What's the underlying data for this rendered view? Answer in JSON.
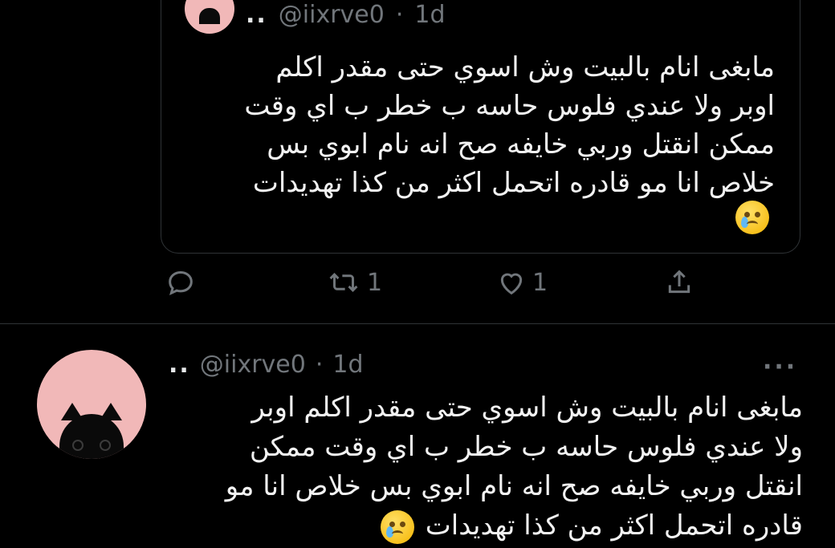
{
  "quote": {
    "author_dots": "..",
    "handle": "@iixrve0",
    "separator": "·",
    "time": "1d",
    "lines": [
      "مابغى انام بالبيت  وش اسوي  حتى مقدر اكلم",
      "اوبر  ولا عندي فلوس حاسه ب خطر ب اي وقت",
      "ممكن انقتل وربي خايفه صح انه نام ابوي بس",
      "خلاص انا مو قادره اتحمل اكثر من كذا تهديدات"
    ],
    "emoji": "crying-face-emoji"
  },
  "actions": {
    "reply_count": "",
    "retweet_count": "1",
    "like_count": "1"
  },
  "reply": {
    "author_dots": "..",
    "handle": "@iixrve0",
    "separator": "·",
    "time": "1d",
    "more": "···",
    "lines": [
      "مابغى انام بالبيت  وش اسوي  حتى مقدر اكلم اوبر",
      "ولا عندي فلوس حاسه ب خطر ب اي وقت ممكن",
      "انقتل وربي خايفه صح انه نام ابوي بس خلاص انا مو",
      "قادره اتحمل اكثر من كذا تهديدات"
    ],
    "emoji": "crying-face-emoji"
  },
  "colors": {
    "background": "#000000",
    "text": "#e7e9ea",
    "muted": "#71767b",
    "border": "#2f3336",
    "avatar": "#f1b8b8"
  }
}
